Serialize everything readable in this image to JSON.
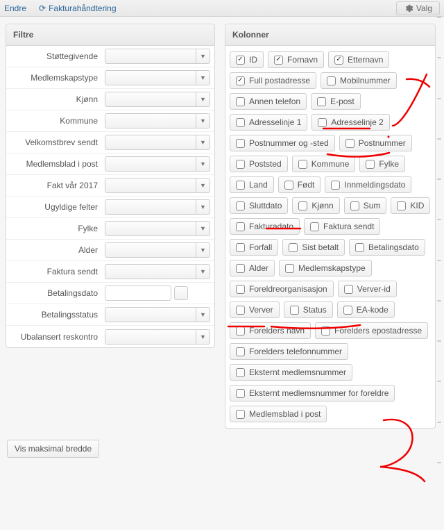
{
  "topbar": {
    "endre": "Endre",
    "faktura": "Fakturahåndtering",
    "valg": "Valg"
  },
  "filtre": {
    "title": "Filtre",
    "rows": [
      {
        "label": "Støttegivende",
        "type": "select"
      },
      {
        "label": "Medlemskapstype",
        "type": "select"
      },
      {
        "label": "Kjønn",
        "type": "select"
      },
      {
        "label": "Kommune",
        "type": "select"
      },
      {
        "label": "Velkomstbrev sendt",
        "type": "select"
      },
      {
        "label": "Medlemsblad i post",
        "type": "select"
      },
      {
        "label": "Fakt vår 2017",
        "type": "select"
      },
      {
        "label": "Ugyldige felter",
        "type": "select"
      },
      {
        "label": "Fylke",
        "type": "select"
      },
      {
        "label": "Alder",
        "type": "select"
      },
      {
        "label": "Faktura sendt",
        "type": "select"
      },
      {
        "label": "Betalingsdato",
        "type": "input_with_btn"
      },
      {
        "label": "Betalingsstatus",
        "type": "select"
      },
      {
        "label": "Ubalansert reskontro",
        "type": "select"
      }
    ]
  },
  "kolonner": {
    "title": "Kolonner",
    "items": [
      {
        "label": "ID",
        "checked": true
      },
      {
        "label": "Fornavn",
        "checked": true
      },
      {
        "label": "Etternavn",
        "checked": true
      },
      {
        "label": "Full postadresse",
        "checked": true
      },
      {
        "label": "Mobilnummer",
        "checked": false
      },
      {
        "label": "Annen telefon",
        "checked": false
      },
      {
        "label": "E-post",
        "checked": false
      },
      {
        "label": "Adresselinje 1",
        "checked": false
      },
      {
        "label": "Adresselinje 2",
        "checked": false
      },
      {
        "label": "Postnummer og -sted",
        "checked": false
      },
      {
        "label": "Postnummer",
        "checked": false
      },
      {
        "label": "Poststed",
        "checked": false
      },
      {
        "label": "Kommune",
        "checked": false
      },
      {
        "label": "Fylke",
        "checked": false
      },
      {
        "label": "Land",
        "checked": false
      },
      {
        "label": "Født",
        "checked": false
      },
      {
        "label": "Innmeldingsdato",
        "checked": false
      },
      {
        "label": "Sluttdato",
        "checked": false
      },
      {
        "label": "Kjønn",
        "checked": false
      },
      {
        "label": "Sum",
        "checked": false
      },
      {
        "label": "KID",
        "checked": false
      },
      {
        "label": "Fakturadato",
        "checked": false
      },
      {
        "label": "Faktura sendt",
        "checked": false
      },
      {
        "label": "Forfall",
        "checked": false
      },
      {
        "label": "Sist betalt",
        "checked": false
      },
      {
        "label": "Betalingsdato",
        "checked": false
      },
      {
        "label": "Alder",
        "checked": false
      },
      {
        "label": "Medlemskapstype",
        "checked": false
      },
      {
        "label": "Foreldreorganisasjon",
        "checked": false
      },
      {
        "label": "Verver-id",
        "checked": false
      },
      {
        "label": "Verver",
        "checked": false
      },
      {
        "label": "Status",
        "checked": false
      },
      {
        "label": "EA-kode",
        "checked": false
      },
      {
        "label": "Forelders navn",
        "checked": false
      },
      {
        "label": "Forelders epostadresse",
        "checked": false
      },
      {
        "label": "Forelders telefonnummer",
        "checked": false
      },
      {
        "label": "Eksternt medlemsnummer",
        "checked": false
      },
      {
        "label": "Eksternt medlemsnummer for foreldre",
        "checked": false
      },
      {
        "label": "Medlemsblad i post",
        "checked": false
      }
    ]
  },
  "footer": {
    "vis_maksimal": "Vis maksimal bredde"
  }
}
